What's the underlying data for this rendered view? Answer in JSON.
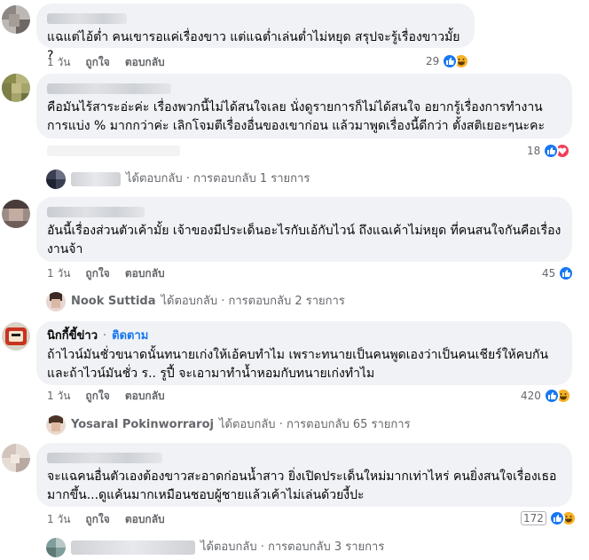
{
  "comments": [
    {
      "name": "",
      "text": "แฉแต่ไอ้ต่ำ คนเขารอแค่เรื่องขาว แต่แฉต่ำเล่นต่ำไม่หยุด สรุปจะรู้เรื่องขาวมั้ย ?",
      "time": "1 วัน",
      "like": "ถูกใจ",
      "reply": "ตอบกลับ",
      "reaction_count": "29",
      "reactions": [
        "like-icon",
        "haha-icon"
      ]
    },
    {
      "name": "",
      "text": "คือมันไร้สาระอ่ะค่ะ เรื่องพวกนี้ไม่ได้สนใจเลย นั่งดูรายการก็ไม่ได้สนใจ อยากรู้เรื่องการทำงานการแบ่ง % มากกว่าค่ะ เลิกโจมตีเรื่องอื่นของเขาก่อน แล้วมาพูดเรื่องนี้ดีกว่า ตั้งสติเยอะๆนะคะ",
      "reaction_count": "18",
      "reactions": [
        "like-icon",
        "love-icon"
      ],
      "replies_text": "ได้ตอบกลับ · การตอบกลับ 1 รายการ"
    },
    {
      "name": "",
      "text": "อันนี้เรื่องส่วนตัวเค้ามั้ย เจ้าของมีประเด็นอะไรกับเอ้กับไวน์ ถึงแฉเค้าไม่หยุด ที่คนสนใจกันคือเรื่องงานจ้า",
      "time": "1 วัน",
      "like": "ถูกใจ",
      "reply": "ตอบกลับ",
      "reaction_count": "45",
      "reactions": [
        "like-icon"
      ],
      "replies_name": "Nook Suttida",
      "replies_text": "ได้ตอบกลับ · การตอบกลับ 2 รายการ"
    },
    {
      "name": "นิกกี้ขี้ข่าว",
      "follow": "ติดตาม",
      "text": "ถ้าไวน์มันชั่วขนาดนั้นทนายเก่งให้เอ้คบทำไม เพราะทนายเป็นคนพูดเองว่าเป็นคนเชียร์ให้คบกัน และถ้าไวน์มันชั่ว ร.. รูปี้ จะเอามาทำน้ำหอมกับทนายเก่งทำไม",
      "time": "1 วัน",
      "like": "ถูกใจ",
      "reply": "ตอบกลับ",
      "reaction_count": "420",
      "reactions": [
        "like-icon",
        "haha-icon"
      ],
      "replies_name": "Yosaral Pokinworraroj",
      "replies_text": "ได้ตอบกลับ · การตอบกลับ 65 รายการ"
    },
    {
      "name": "",
      "text": "จะแฉคนอื่นตัวเองต้องขาวสะอาดก่อนน้ำสาว ยิ่งเปิดประเด็นใหม่มากเท่าไหร่ คนยิ่งสนใจเรื่องเธอมากขึ้น...ดูแค้นมากเหมือนชอบผู้ชายแล้วเค้าไม่เล่นด้วยงี้ปะ",
      "time": "1 วัน",
      "like": "ถูกใจ",
      "reply": "ตอบกลับ",
      "reaction_count": "172",
      "reactions": [
        "like-icon",
        "haha-icon"
      ],
      "replies_text": "ได้ตอบกลับ · การตอบกลับ 3 รายการ"
    }
  ],
  "colors": {
    "bubble": "#f0f2f5",
    "meta": "#65676b",
    "like": "#1877f2",
    "haha": "#f7b125",
    "love": "#f33e58",
    "follow": "#1877f2"
  }
}
